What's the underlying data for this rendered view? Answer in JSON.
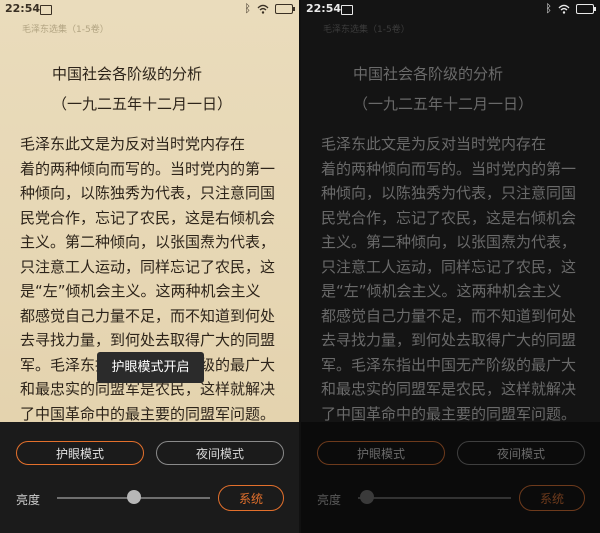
{
  "status_bar": {
    "time": "22:54",
    "icons": [
      "image-icon",
      "bluetooth-icon",
      "wifi-icon",
      "battery-icon"
    ]
  },
  "book": {
    "title": "毛泽东选集（1-5卷）"
  },
  "chapter": {
    "title": "中国社会各阶级的分析",
    "date": "（一九二五年十二月一日）"
  },
  "body_lines": [
    "毛泽东此文是为反对当时党内存在",
    "着的两种倾向而写的。当时党内的第一",
    "种倾向，以陈独秀为代表，只注意同国",
    "民党合作，忘记了农民，这是右倾机会",
    "主义。第二种倾向，以张国焘为代表，",
    "只注意工人运动，同样忘记了农民，这",
    "是“左”倾机会主义。这两种机会主义",
    "都感觉自己力量不足，而不知道到何处",
    "去寻找力量，到何处去取得广大的同盟",
    "军。毛泽东指出中国无产阶级的最广大",
    "和最忠实的同盟军是农民，这样就解决",
    "了中国革命中的最主要的同盟军问题。"
  ],
  "toast": {
    "text": "护眼模式开启"
  },
  "display_settings": {
    "eye_mode_label": "护眼模式",
    "night_mode_label": "夜间模式",
    "brightness_label": "亮度",
    "system_label": "系统",
    "brightness_left": 0.5,
    "brightness_right": 0.06
  },
  "colors": {
    "accent": "#e3702c",
    "paper": "#eadcbc",
    "night_bg": "#141414"
  }
}
